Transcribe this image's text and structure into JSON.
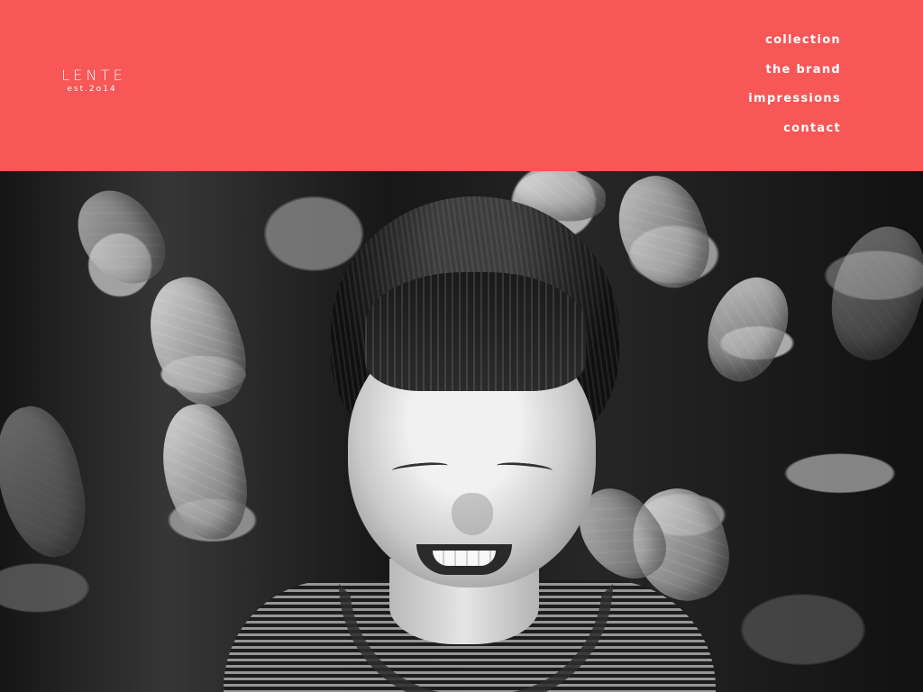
{
  "brand": {
    "name": "LENTE",
    "established": "est.2o14"
  },
  "navigation": {
    "items": [
      {
        "label": "collection"
      },
      {
        "label": "the brand"
      },
      {
        "label": "impressions"
      },
      {
        "label": "contact"
      }
    ]
  },
  "hero": {
    "image_alt": "Black and white photo of a smiling child among leaves"
  },
  "colors": {
    "header_background": "#F75757",
    "header_text": "#FFFFFF"
  },
  "icons": {
    "hero": "child-portrait-photo"
  }
}
